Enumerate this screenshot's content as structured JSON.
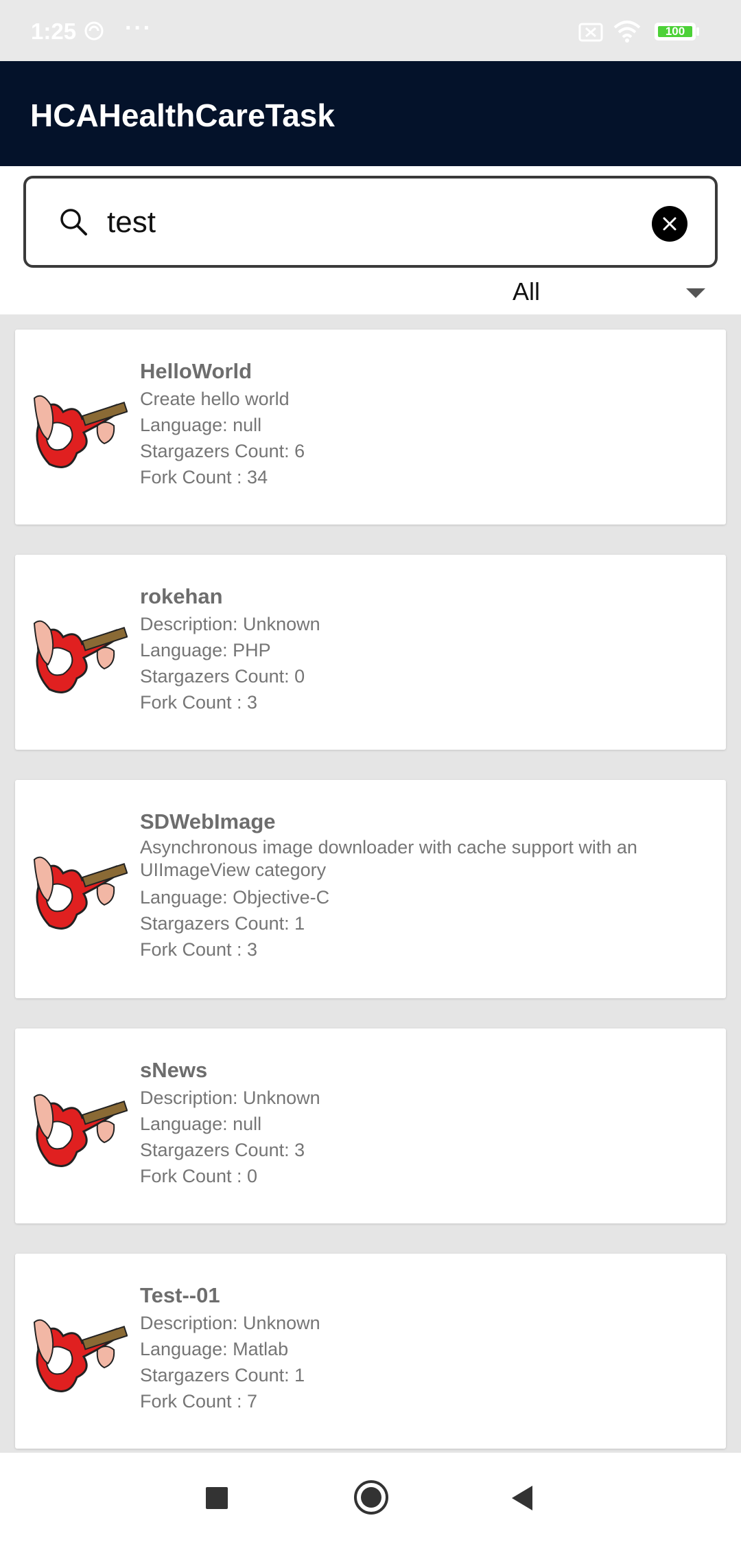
{
  "status_bar": {
    "time": "1:25",
    "more": "···",
    "battery_level": "100"
  },
  "app": {
    "title": "HCAHealthCareTask"
  },
  "search": {
    "value": "test",
    "icon": "search-icon",
    "clear_icon": "close-icon"
  },
  "filter": {
    "selected": "All"
  },
  "repos": [
    {
      "name": "HelloWorld",
      "description": "Create hello world",
      "language": "Language: null",
      "stargazers": "Stargazers Count: 6",
      "forks": "Fork Count : 34"
    },
    {
      "name": "rokehan",
      "description": "Description: Unknown",
      "language": "Language: PHP",
      "stargazers": "Stargazers Count: 0",
      "forks": "Fork Count : 3"
    },
    {
      "name": "SDWebImage",
      "description": "Asynchronous image downloader with cache support with an UIImageView category",
      "language": "Language: Objective-C",
      "stargazers": "Stargazers Count: 1",
      "forks": "Fork Count : 3"
    },
    {
      "name": "sNews",
      "description": "Description: Unknown",
      "language": "Language: null",
      "stargazers": "Stargazers Count: 3",
      "forks": "Fork Count : 0"
    },
    {
      "name": "Test--01",
      "description": "Description: Unknown",
      "language": "Language: Matlab",
      "stargazers": "Stargazers Count: 1",
      "forks": "Fork Count : 7"
    }
  ],
  "colors": {
    "app_bar": "#04122a",
    "background": "#e5e5e5",
    "card": "#ffffff",
    "battery": "#4cd137"
  }
}
